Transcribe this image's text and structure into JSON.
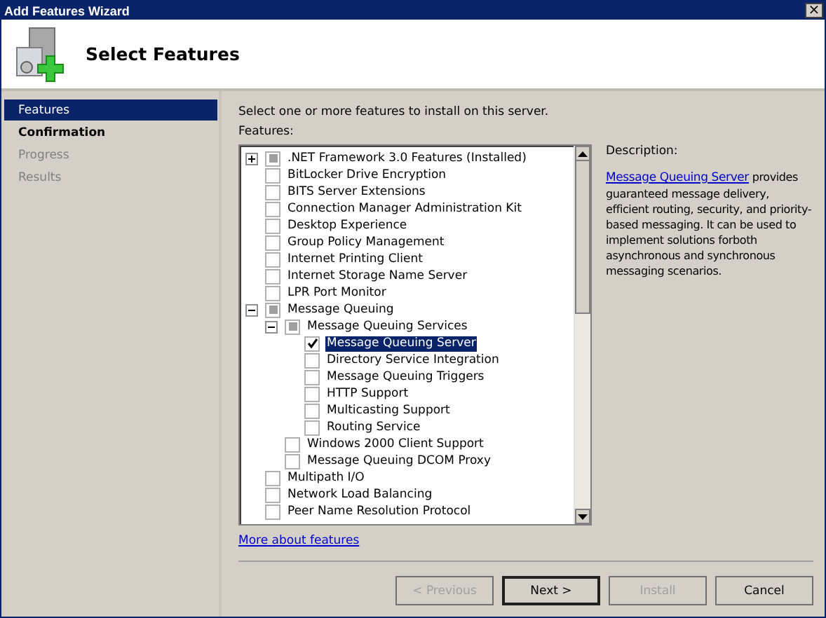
{
  "window": {
    "title": "Add Features Wizard",
    "close": "×"
  },
  "header": {
    "title": "Select Features"
  },
  "steps": [
    {
      "label": "Features",
      "selected": true,
      "disabled": false
    },
    {
      "label": "Confirmation",
      "selected": false,
      "disabled": false
    },
    {
      "label": "Progress",
      "selected": false,
      "disabled": true
    },
    {
      "label": "Results",
      "selected": false,
      "disabled": true
    }
  ],
  "intro": "Select one or more features to install on this server.",
  "features_label": "Features:",
  "features": [
    {
      "label": ".NET Framework 3.0 Features  (Installed)",
      "partial": true,
      "selected": false,
      "expanded": false
    },
    {
      "label": "BitLocker Drive Encryption",
      "checked": false,
      "selected": false
    },
    {
      "label": "BITS Server Extensions",
      "checked": false,
      "selected": false
    },
    {
      "label": "Connection Manager Administration Kit",
      "checked": false,
      "selected": false
    },
    {
      "label": "Desktop Experience",
      "checked": false,
      "selected": false
    },
    {
      "label": "Group Policy Management",
      "checked": false,
      "selected": false
    },
    {
      "label": "Internet Printing Client",
      "checked": false,
      "selected": false
    },
    {
      "label": "Internet Storage Name Server",
      "checked": false,
      "selected": false
    },
    {
      "label": "LPR Port Monitor",
      "checked": false,
      "selected": false
    },
    {
      "label": "Message Queuing",
      "partial": true,
      "selected": false,
      "expanded": true,
      "children": [
        {
          "label": "Message Queuing Services",
          "partial": true,
          "selected": false,
          "expanded": true,
          "children": [
            {
              "label": "Message Queuing Server",
              "checked": true,
              "selected": true
            },
            {
              "label": "Directory Service Integration",
              "checked": false,
              "selected": false
            },
            {
              "label": "Message Queuing Triggers",
              "checked": false,
              "selected": false
            },
            {
              "label": "HTTP Support",
              "checked": false,
              "selected": false
            },
            {
              "label": "Multicasting Support",
              "checked": false,
              "selected": false
            },
            {
              "label": "Routing Service",
              "checked": false,
              "selected": false
            }
          ]
        },
        {
          "label": "Windows 2000 Client Support",
          "checked": false,
          "selected": false
        },
        {
          "label": "Message Queuing DCOM Proxy",
          "checked": false,
          "selected": false
        }
      ]
    },
    {
      "label": "Multipath I/O",
      "checked": false,
      "selected": false
    },
    {
      "label": "Network Load Balancing",
      "checked": false,
      "selected": false
    },
    {
      "label": "Peer Name Resolution Protocol",
      "checked": false,
      "selected": false
    }
  ],
  "more_link": "More about features",
  "description": {
    "label": "Description:",
    "link": "Message Queuing Server",
    "text": " provides guaranteed message delivery, efficient routing, security, and priority-based messaging. It can be used to implement solutions forboth asynchronous and synchronous messaging scenarios."
  },
  "buttons": [
    {
      "label": "< Previous",
      "disabled": true,
      "default": false
    },
    {
      "label": "Next >",
      "disabled": false,
      "default": true
    },
    {
      "label": "Install",
      "disabled": true,
      "default": false
    },
    {
      "label": "Cancel",
      "disabled": false,
      "default": false
    }
  ]
}
